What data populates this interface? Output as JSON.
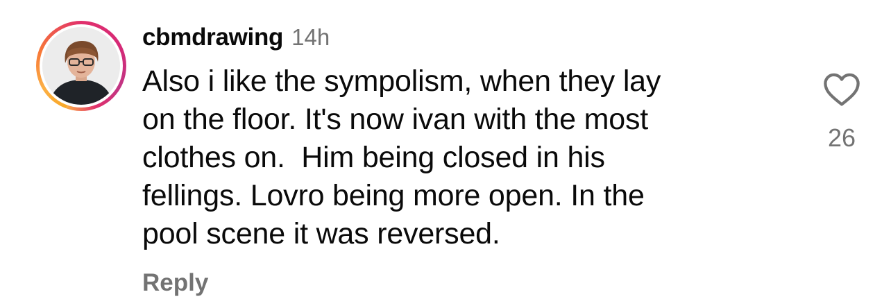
{
  "comment": {
    "username": "cbmdrawing",
    "time": "14h",
    "text_lines": [
      "Also i like the sympolism, when they lay",
      "on the floor. It's now ivan with the most",
      "clothes on.  Him being closed in his",
      "fellings. Lovro being more open. In the",
      "pool scene it was reversed."
    ],
    "reply_label": "Reply",
    "like_count": "26",
    "like_icon": "heart-outline-icon",
    "colors": {
      "text": "#0a0a0a",
      "secondary": "#737373",
      "ring_start": "#fcaf45",
      "ring_end": "#c13584"
    }
  }
}
